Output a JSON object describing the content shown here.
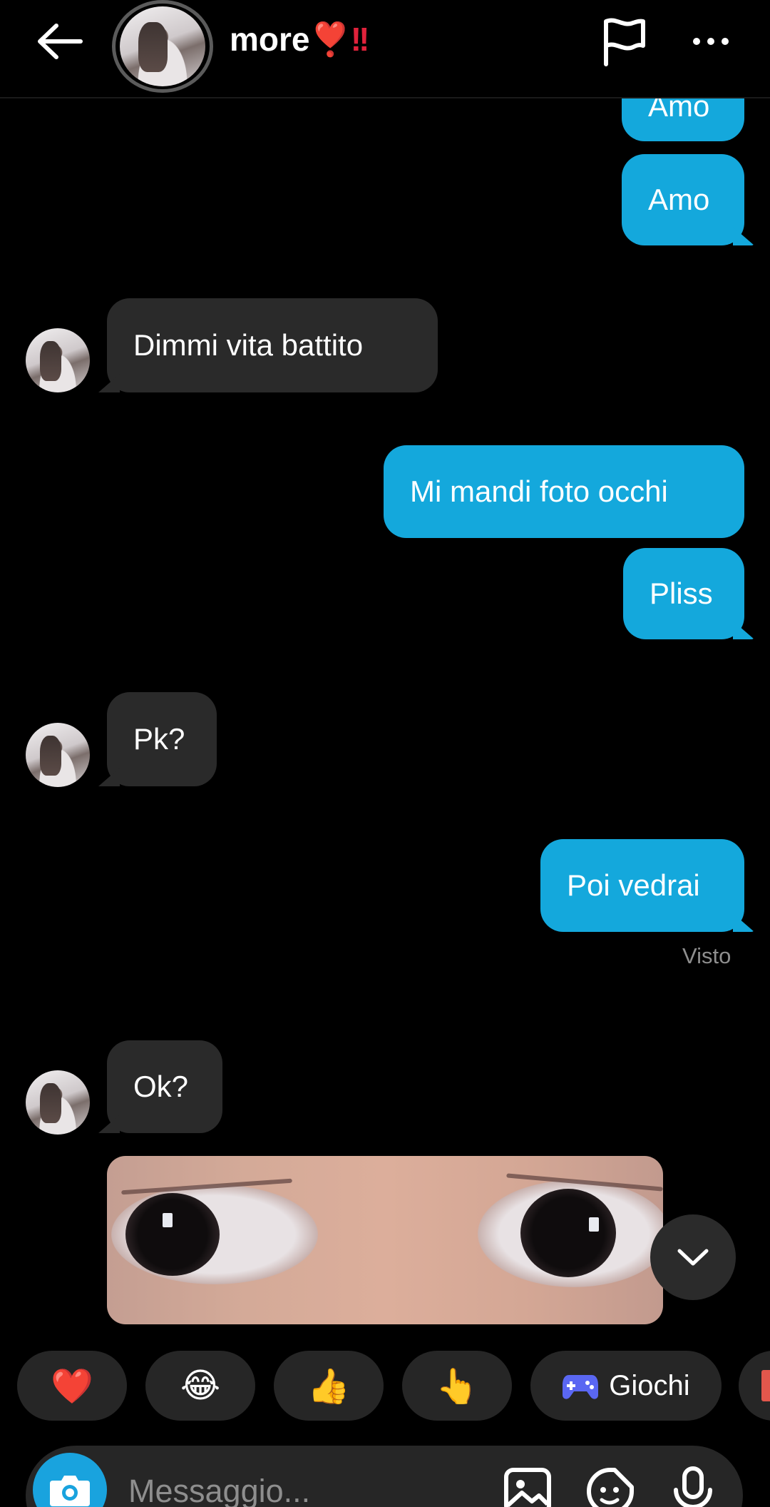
{
  "header": {
    "title": "more",
    "title_heart": "❣️",
    "title_bang": "!!"
  },
  "messages": [
    {
      "from": "me",
      "text": "Amo"
    },
    {
      "from": "me",
      "text": "Amo"
    },
    {
      "from": "them",
      "text": "Dimmi vita battito"
    },
    {
      "from": "me",
      "text": "Mi mandi foto occhi"
    },
    {
      "from": "me",
      "text": "Pliss"
    },
    {
      "from": "them",
      "text": "Pk?"
    },
    {
      "from": "me",
      "text": "Poi vedrai"
    },
    {
      "from": "them",
      "text": "Ok?"
    }
  ],
  "seen_label": "Visto",
  "reactions": [
    {
      "icon": "heart-icon",
      "emoji": "❤️"
    },
    {
      "icon": "laughing-emoji-icon",
      "emoji": "😂"
    },
    {
      "icon": "thumbs-up-icon",
      "emoji": "👍"
    },
    {
      "icon": "pointing-hand-icon",
      "emoji": "👆"
    }
  ],
  "games": {
    "label": "Giochi",
    "icon": "gamepad-icon",
    "color": "#5a67f2"
  },
  "composer": {
    "placeholder": "Messaggio..."
  },
  "colors": {
    "sent_bubble": "#14a8dc",
    "received_bubble": "#2a2a2a",
    "background": "#000000",
    "accent": "#19a3de"
  }
}
